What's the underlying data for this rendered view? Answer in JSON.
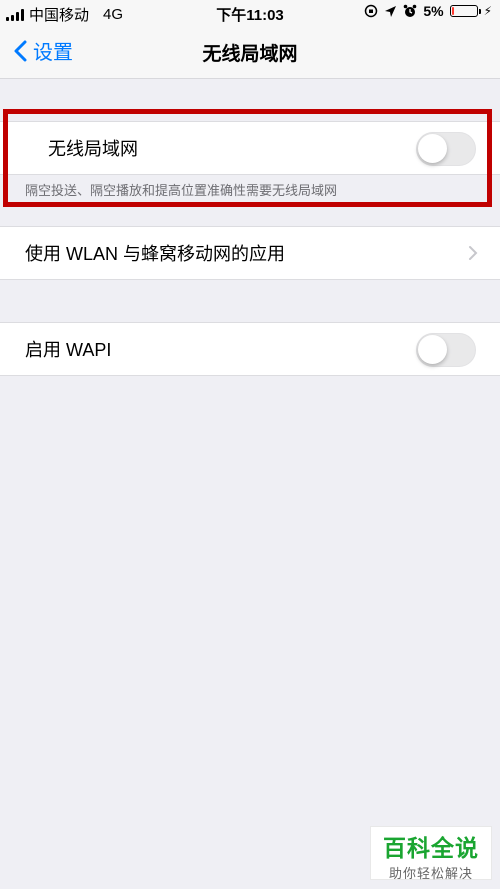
{
  "status_bar": {
    "carrier": "中国移动",
    "network": "4G",
    "time": "下午11:03",
    "battery_percent_text": "5%",
    "battery_level": 0.05
  },
  "nav": {
    "back_label": "设置",
    "title": "无线局域网"
  },
  "wlan": {
    "label": "无线局域网",
    "enabled": false,
    "note": "隔空投送、隔空播放和提高位置准确性需要无线局域网"
  },
  "apps_row": {
    "label": "使用 WLAN 与蜂窝移动网的应用"
  },
  "wapi": {
    "label": "启用 WAPI",
    "enabled": false
  },
  "watermark": {
    "brand": "百科全说",
    "slogan": "助你轻松解决"
  },
  "colors": {
    "accent": "#007aff",
    "highlight_border": "#c00000",
    "watermark_green": "#1aa531",
    "background": "#efeff4"
  }
}
